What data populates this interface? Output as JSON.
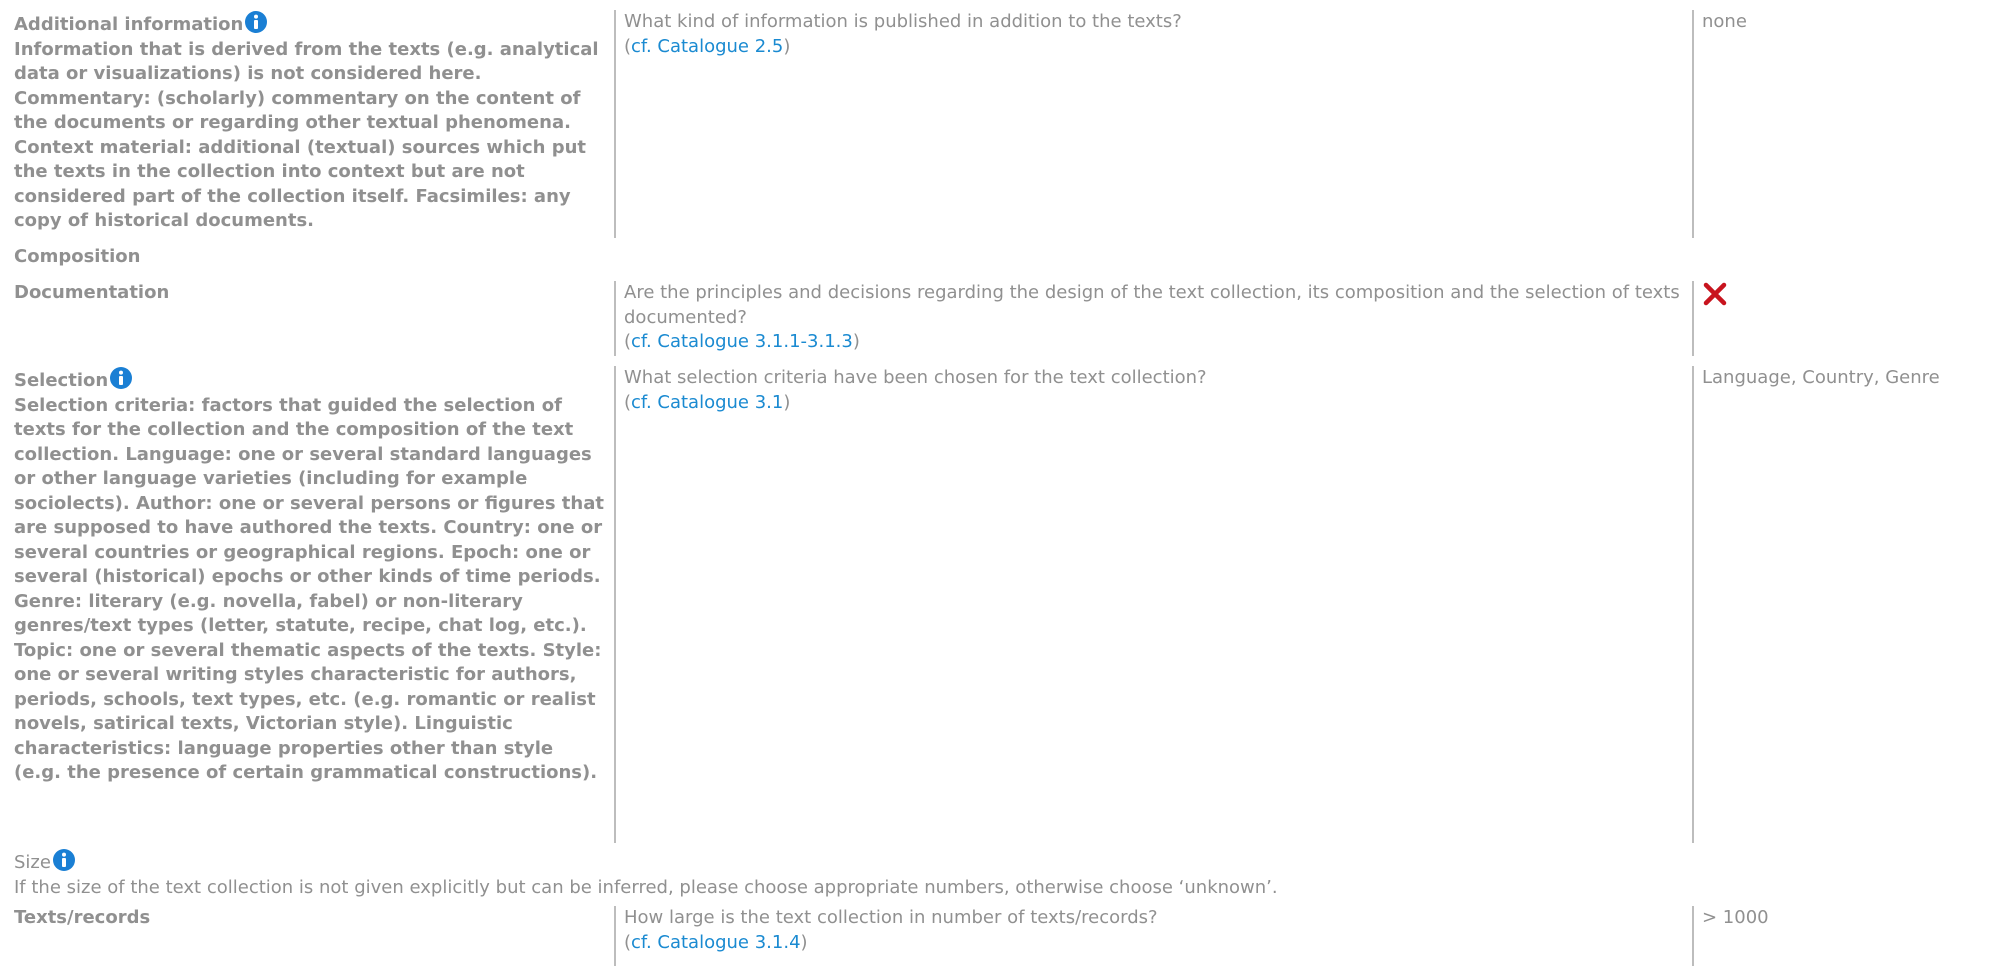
{
  "rows": {
    "additional": {
      "title": "Additional information",
      "description": "Information that is derived from the texts (e.g. analytical data or visualizations) is not considered here. Commentary: (scholarly) commentary on the content of the documents or regarding other textual phenomena. Context material: additional (textual) sources which put the texts in the collection into context but are not considered part of the collection itself. Facsimiles: any copy of historical documents.",
      "question": "What kind of information is published in addition to the texts?",
      "ref_open": "(",
      "ref_link": "cf. Catalogue 2.5",
      "ref_close": ")",
      "answer": "none"
    },
    "composition": {
      "title": "Composition"
    },
    "documentation": {
      "title": "Documentation",
      "question": "Are the principles and decisions regarding the design of the text collection, its composition and the selection of texts documented?",
      "ref_open": "(",
      "ref_link": "cf. Catalogue 3.1.1-3.1.3",
      "ref_close": ")",
      "answer_icon": "red-cross-icon"
    },
    "selection": {
      "title": "Selection",
      "description": "Selection criteria: factors that guided the selection of texts for the collection and the composition of the text collection. Language: one or several standard languages or other language varieties (including for example sociolects). Author: one or several persons or figures that are supposed to have authored the texts. Country: one or several countries or geographical regions. Epoch: one or several (historical) epochs or other kinds of time periods. Genre: literary (e.g. novella, fabel) or non-literary genres/text types (letter, statute, recipe, chat log, etc.). Topic: one or several thematic aspects of the texts. Style: one or several writing styles characteristic for authors, periods, schools, text types, etc. (e.g. romantic or realist novels, satirical texts, Victorian style). Linguistic characteristics: language properties other than style (e.g. the presence of certain grammatical constructions).",
      "question": "What selection criteria have been chosen for the text collection?",
      "ref_open": "(",
      "ref_link": "cf. Catalogue 3.1",
      "ref_close": ")",
      "answer": "Language, Country, Genre"
    },
    "size": {
      "title": "Size",
      "description": "If the size of the text collection is not given explicitly but can be inferred, please choose appropriate numbers, otherwise choose ‘unknown’."
    },
    "texts_records": {
      "title": "Texts/records",
      "question": "How large is the text collection in number of texts/records?",
      "ref_open": "(",
      "ref_link": "cf. Catalogue 3.1.4",
      "ref_close": ")",
      "answer": "> 1000"
    }
  },
  "colors": {
    "text": "#909090",
    "link": "#1a8ad1",
    "divider": "#bdbdbd",
    "info_icon": "#1a7fd4",
    "cross": "#c8141e"
  }
}
